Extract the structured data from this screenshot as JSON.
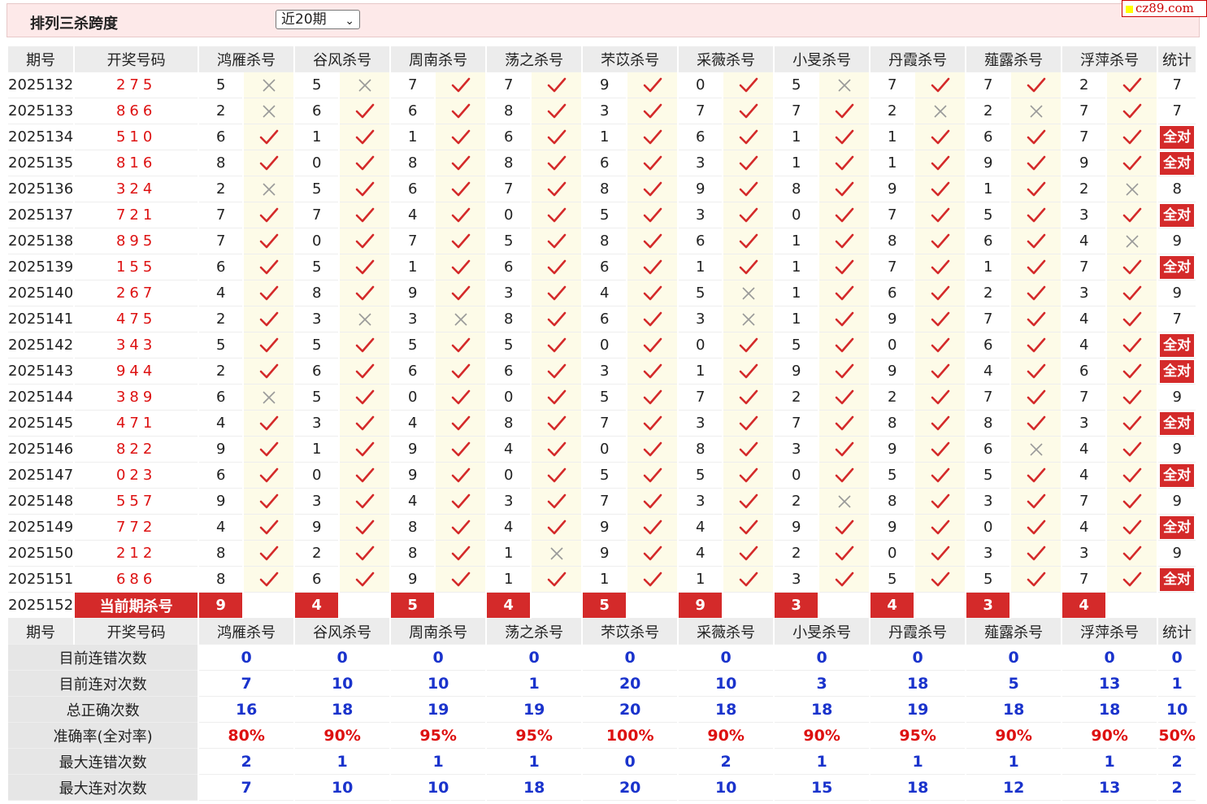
{
  "page": {
    "title": "排列三杀跨度",
    "period_select": "近20期",
    "logo": "cz89.com"
  },
  "colors": {
    "accent_red": "#d42a2a",
    "stat_blue": "#1a33cc",
    "mark_bg": "#fdfbe8"
  },
  "headers": {
    "issue": "期号",
    "draw": "开奖号码",
    "experts": [
      "鸿雁杀号",
      "谷风杀号",
      "周南杀号",
      "荡之杀号",
      "芣苡杀号",
      "采薇杀号",
      "小旻杀号",
      "丹霞杀号",
      "薤露杀号",
      "浮萍杀号"
    ],
    "stat": "统计"
  },
  "rows": [
    {
      "issue": "2025132",
      "draw": "275",
      "kills": [
        "5",
        "5",
        "7",
        "7",
        "9",
        "0",
        "5",
        "7",
        "7",
        "2"
      ],
      "marks": [
        "x",
        "x",
        "v",
        "v",
        "v",
        "v",
        "x",
        "v",
        "v",
        "v"
      ],
      "stat": "7"
    },
    {
      "issue": "2025133",
      "draw": "866",
      "kills": [
        "2",
        "6",
        "6",
        "8",
        "3",
        "7",
        "7",
        "2",
        "2",
        "7"
      ],
      "marks": [
        "x",
        "v",
        "v",
        "v",
        "v",
        "v",
        "v",
        "x",
        "x",
        "v"
      ],
      "stat": "7"
    },
    {
      "issue": "2025134",
      "draw": "510",
      "kills": [
        "6",
        "1",
        "1",
        "6",
        "1",
        "6",
        "1",
        "1",
        "6",
        "7"
      ],
      "marks": [
        "v",
        "v",
        "v",
        "v",
        "v",
        "v",
        "v",
        "v",
        "v",
        "v"
      ],
      "stat": "全对"
    },
    {
      "issue": "2025135",
      "draw": "816",
      "kills": [
        "8",
        "0",
        "8",
        "8",
        "6",
        "3",
        "1",
        "1",
        "9",
        "9"
      ],
      "marks": [
        "v",
        "v",
        "v",
        "v",
        "v",
        "v",
        "v",
        "v",
        "v",
        "v"
      ],
      "stat": "全对"
    },
    {
      "issue": "2025136",
      "draw": "324",
      "kills": [
        "2",
        "5",
        "6",
        "7",
        "8",
        "9",
        "8",
        "9",
        "1",
        "2"
      ],
      "marks": [
        "x",
        "v",
        "v",
        "v",
        "v",
        "v",
        "v",
        "v",
        "v",
        "x"
      ],
      "stat": "8"
    },
    {
      "issue": "2025137",
      "draw": "721",
      "kills": [
        "7",
        "7",
        "4",
        "0",
        "5",
        "3",
        "0",
        "7",
        "5",
        "3"
      ],
      "marks": [
        "v",
        "v",
        "v",
        "v",
        "v",
        "v",
        "v",
        "v",
        "v",
        "v"
      ],
      "stat": "全对"
    },
    {
      "issue": "2025138",
      "draw": "895",
      "kills": [
        "7",
        "0",
        "7",
        "5",
        "8",
        "6",
        "1",
        "8",
        "6",
        "4"
      ],
      "marks": [
        "v",
        "v",
        "v",
        "v",
        "v",
        "v",
        "v",
        "v",
        "v",
        "x"
      ],
      "stat": "9"
    },
    {
      "issue": "2025139",
      "draw": "155",
      "kills": [
        "6",
        "5",
        "1",
        "6",
        "6",
        "1",
        "1",
        "7",
        "1",
        "7"
      ],
      "marks": [
        "v",
        "v",
        "v",
        "v",
        "v",
        "v",
        "v",
        "v",
        "v",
        "v"
      ],
      "stat": "全对"
    },
    {
      "issue": "2025140",
      "draw": "267",
      "kills": [
        "4",
        "8",
        "9",
        "3",
        "4",
        "5",
        "1",
        "6",
        "2",
        "3"
      ],
      "marks": [
        "v",
        "v",
        "v",
        "v",
        "v",
        "x",
        "v",
        "v",
        "v",
        "v"
      ],
      "stat": "9"
    },
    {
      "issue": "2025141",
      "draw": "475",
      "kills": [
        "2",
        "3",
        "3",
        "8",
        "6",
        "3",
        "1",
        "9",
        "7",
        "4"
      ],
      "marks": [
        "v",
        "x",
        "x",
        "v",
        "v",
        "x",
        "v",
        "v",
        "v",
        "v"
      ],
      "stat": "7"
    },
    {
      "issue": "2025142",
      "draw": "343",
      "kills": [
        "5",
        "5",
        "5",
        "5",
        "0",
        "0",
        "5",
        "0",
        "6",
        "4"
      ],
      "marks": [
        "v",
        "v",
        "v",
        "v",
        "v",
        "v",
        "v",
        "v",
        "v",
        "v"
      ],
      "stat": "全对"
    },
    {
      "issue": "2025143",
      "draw": "944",
      "kills": [
        "2",
        "6",
        "6",
        "6",
        "3",
        "1",
        "9",
        "9",
        "4",
        "6"
      ],
      "marks": [
        "v",
        "v",
        "v",
        "v",
        "v",
        "v",
        "v",
        "v",
        "v",
        "v"
      ],
      "stat": "全对"
    },
    {
      "issue": "2025144",
      "draw": "389",
      "kills": [
        "6",
        "5",
        "0",
        "0",
        "5",
        "7",
        "2",
        "2",
        "7",
        "7"
      ],
      "marks": [
        "x",
        "v",
        "v",
        "v",
        "v",
        "v",
        "v",
        "v",
        "v",
        "v"
      ],
      "stat": "9"
    },
    {
      "issue": "2025145",
      "draw": "471",
      "kills": [
        "4",
        "3",
        "4",
        "8",
        "7",
        "3",
        "7",
        "8",
        "8",
        "3"
      ],
      "marks": [
        "v",
        "v",
        "v",
        "v",
        "v",
        "v",
        "v",
        "v",
        "v",
        "v"
      ],
      "stat": "全对"
    },
    {
      "issue": "2025146",
      "draw": "822",
      "kills": [
        "9",
        "1",
        "9",
        "4",
        "0",
        "8",
        "3",
        "9",
        "6",
        "4"
      ],
      "marks": [
        "v",
        "v",
        "v",
        "v",
        "v",
        "v",
        "v",
        "v",
        "x",
        "v"
      ],
      "stat": "9"
    },
    {
      "issue": "2025147",
      "draw": "023",
      "kills": [
        "6",
        "0",
        "9",
        "0",
        "5",
        "5",
        "0",
        "5",
        "5",
        "4"
      ],
      "marks": [
        "v",
        "v",
        "v",
        "v",
        "v",
        "v",
        "v",
        "v",
        "v",
        "v"
      ],
      "stat": "全对"
    },
    {
      "issue": "2025148",
      "draw": "557",
      "kills": [
        "9",
        "3",
        "4",
        "3",
        "7",
        "3",
        "2",
        "8",
        "3",
        "7"
      ],
      "marks": [
        "v",
        "v",
        "v",
        "v",
        "v",
        "v",
        "x",
        "v",
        "v",
        "v"
      ],
      "stat": "9"
    },
    {
      "issue": "2025149",
      "draw": "772",
      "kills": [
        "4",
        "9",
        "8",
        "4",
        "9",
        "4",
        "9",
        "9",
        "0",
        "4"
      ],
      "marks": [
        "v",
        "v",
        "v",
        "v",
        "v",
        "v",
        "v",
        "v",
        "v",
        "v"
      ],
      "stat": "全对"
    },
    {
      "issue": "2025150",
      "draw": "212",
      "kills": [
        "8",
        "2",
        "8",
        "1",
        "9",
        "4",
        "2",
        "0",
        "3",
        "3"
      ],
      "marks": [
        "v",
        "v",
        "v",
        "x",
        "v",
        "v",
        "v",
        "v",
        "v",
        "v"
      ],
      "stat": "9"
    },
    {
      "issue": "2025151",
      "draw": "686",
      "kills": [
        "8",
        "6",
        "9",
        "1",
        "1",
        "1",
        "3",
        "5",
        "5",
        "7"
      ],
      "marks": [
        "v",
        "v",
        "v",
        "v",
        "v",
        "v",
        "v",
        "v",
        "v",
        "v"
      ],
      "stat": "全对"
    }
  ],
  "current": {
    "issue": "2025152",
    "label": "当前期杀号",
    "kills": [
      "9",
      "4",
      "5",
      "4",
      "5",
      "9",
      "3",
      "4",
      "3",
      "4"
    ]
  },
  "summary": [
    {
      "label": "目前连错次数",
      "values": [
        "0",
        "0",
        "0",
        "0",
        "0",
        "0",
        "0",
        "0",
        "0",
        "0",
        "0"
      ],
      "kind": "num"
    },
    {
      "label": "目前连对次数",
      "values": [
        "7",
        "10",
        "10",
        "1",
        "20",
        "10",
        "3",
        "18",
        "5",
        "13",
        "1"
      ],
      "kind": "num"
    },
    {
      "label": "总正确次数",
      "values": [
        "16",
        "18",
        "19",
        "19",
        "20",
        "18",
        "18",
        "19",
        "18",
        "18",
        "10"
      ],
      "kind": "num"
    },
    {
      "label": "准确率(全对率)",
      "values": [
        "80%",
        "90%",
        "95%",
        "95%",
        "100%",
        "90%",
        "90%",
        "95%",
        "90%",
        "90%",
        "50%"
      ],
      "kind": "pct"
    },
    {
      "label": "最大连错次数",
      "values": [
        "2",
        "1",
        "1",
        "1",
        "0",
        "2",
        "1",
        "1",
        "1",
        "1",
        "2"
      ],
      "kind": "num"
    },
    {
      "label": "最大连对次数",
      "values": [
        "7",
        "10",
        "10",
        "18",
        "20",
        "10",
        "15",
        "18",
        "12",
        "13",
        "2"
      ],
      "kind": "num"
    }
  ]
}
